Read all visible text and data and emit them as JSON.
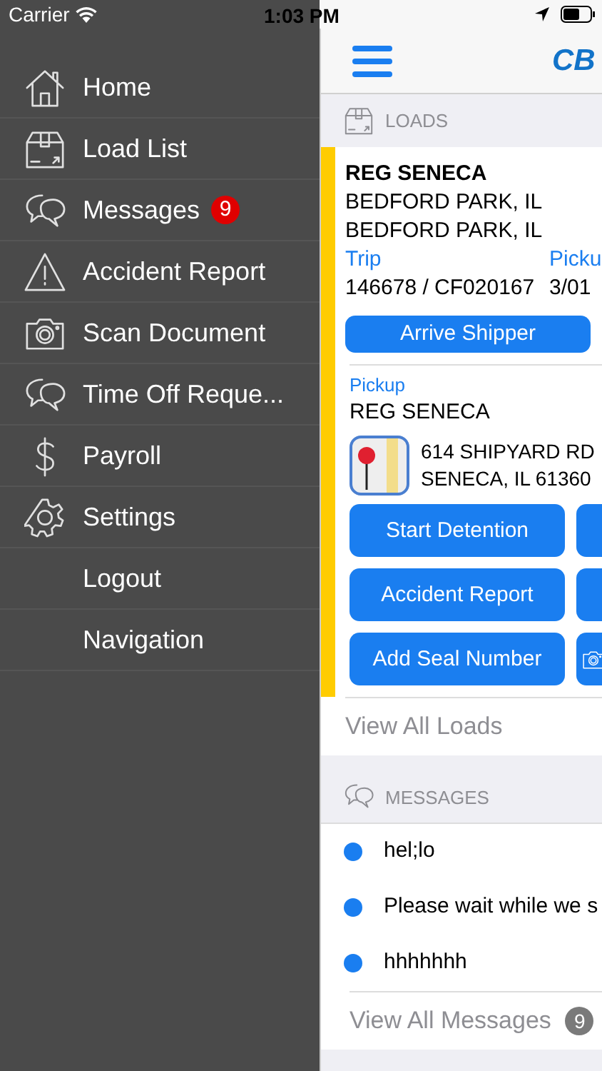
{
  "status_bar": {
    "carrier": "Carrier",
    "time": "1:03 PM"
  },
  "menu": {
    "items": [
      {
        "label": "Home"
      },
      {
        "label": "Load List"
      },
      {
        "label": "Messages",
        "badge": "9"
      },
      {
        "label": "Accident Report"
      },
      {
        "label": "Scan Document"
      },
      {
        "label": "Time Off Reque..."
      },
      {
        "label": "Payroll"
      },
      {
        "label": "Settings"
      },
      {
        "label": "Logout"
      },
      {
        "label": "Navigation"
      }
    ]
  },
  "nav_bar": {
    "logo": "CB"
  },
  "loads": {
    "header": "LOADS",
    "load": {
      "name": "REG SENECA",
      "origin": "BEDFORD PARK, IL",
      "destination": "BEDFORD PARK, IL",
      "fields": [
        {
          "label": "Trip",
          "value": "146678 / CF020167"
        },
        {
          "label": "Picku",
          "value": "3/01"
        }
      ],
      "primary_action": "Arrive Shipper",
      "stop": {
        "type_label": "Pickup",
        "name": "REG SENECA",
        "address_lines": [
          "614 SHIPYARD RD",
          "SENECA, IL 61360"
        ],
        "actions": [
          {
            "label": "Start Detention"
          },
          {
            "label": "Accident Report"
          },
          {
            "label": "Add Seal Number"
          }
        ]
      }
    },
    "footer": "View All Loads"
  },
  "messages": {
    "header": "MESSAGES",
    "items": [
      {
        "text": "hel;lo",
        "unread": true
      },
      {
        "text": "Please wait while we s",
        "unread": true
      },
      {
        "text": "hhhhhhh",
        "unread": true
      }
    ],
    "footer": "View All Messages",
    "count": "9"
  }
}
